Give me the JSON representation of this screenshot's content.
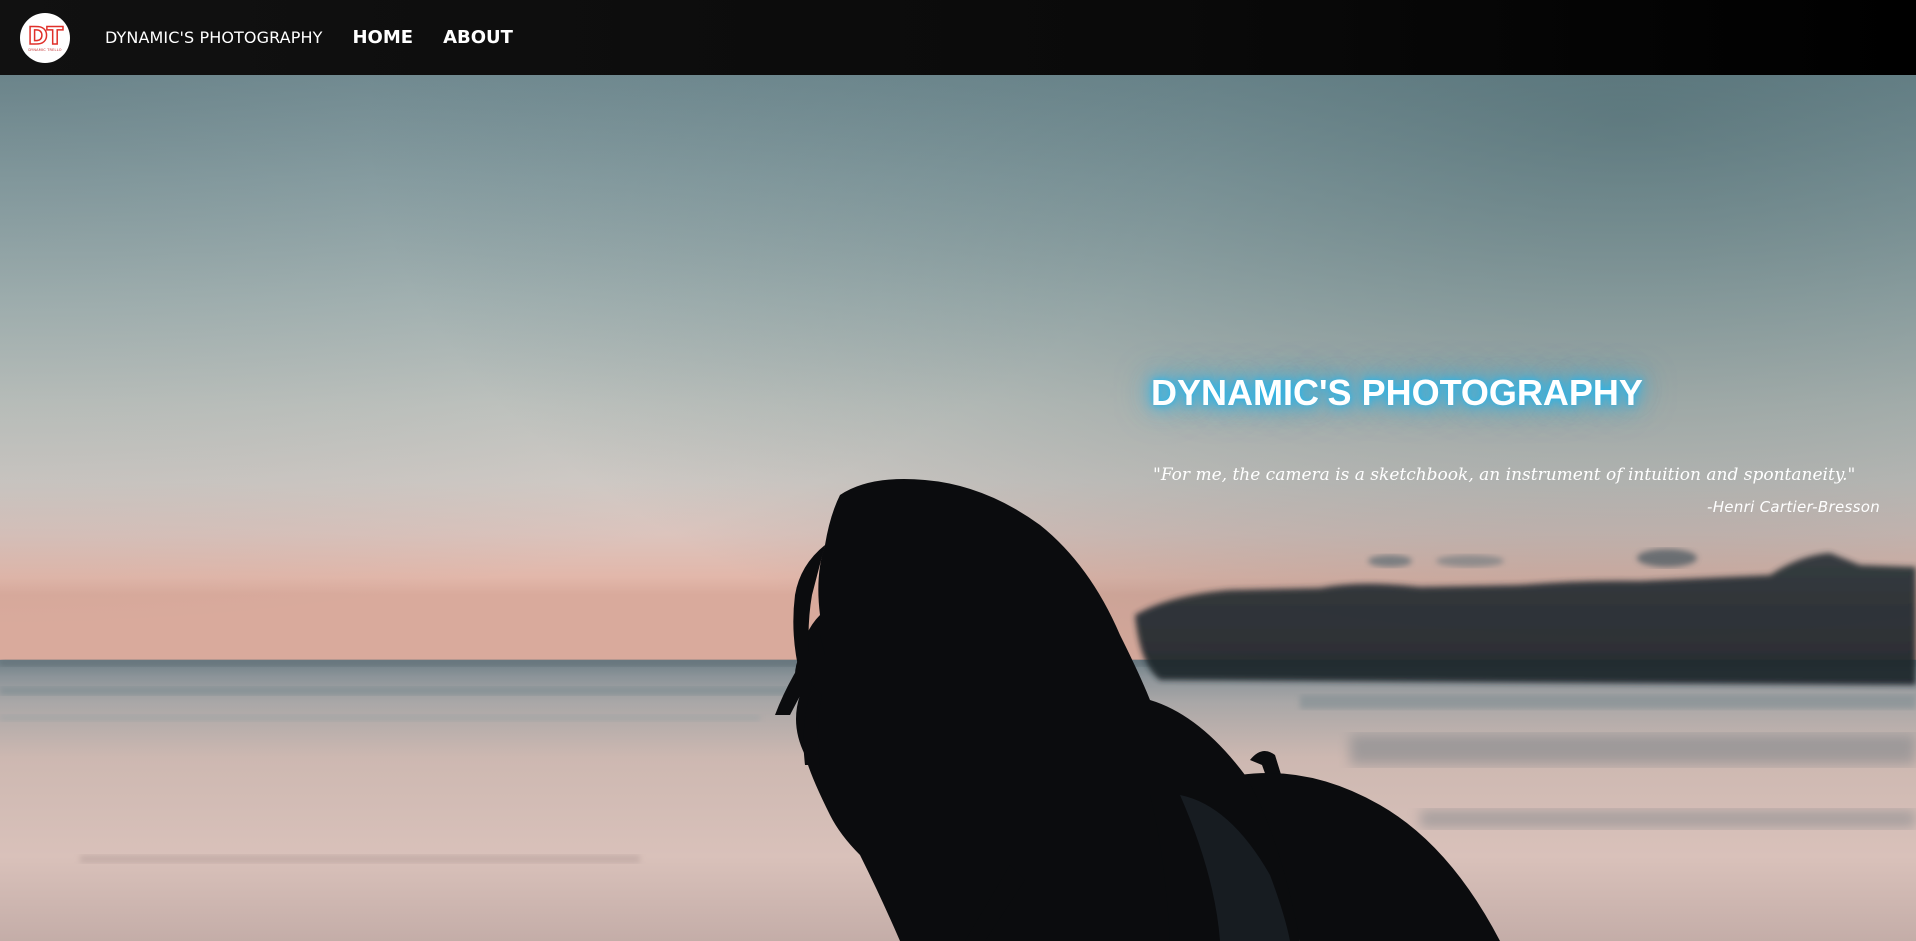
{
  "navbar": {
    "logo": {
      "mark": "DT",
      "sub": "DYNAMIC TRELLO"
    },
    "brand": "DYNAMIC'S PHOTOGRAPHY",
    "links": [
      {
        "label": "HOME"
      },
      {
        "label": "ABOUT"
      }
    ]
  },
  "hero": {
    "title": "DYNAMIC'S PHOTOGRAPHY",
    "quote": "\"For me, the camera is a sketchbook, an instrument of intuition and spontaneity.\"",
    "author": "-Henri Cartier-Bresson"
  },
  "colors": {
    "navbar_bg": "#0d0d0d",
    "title_glow": "#2ab4e8",
    "logo_red": "#e0302a",
    "text": "#ffffff"
  }
}
